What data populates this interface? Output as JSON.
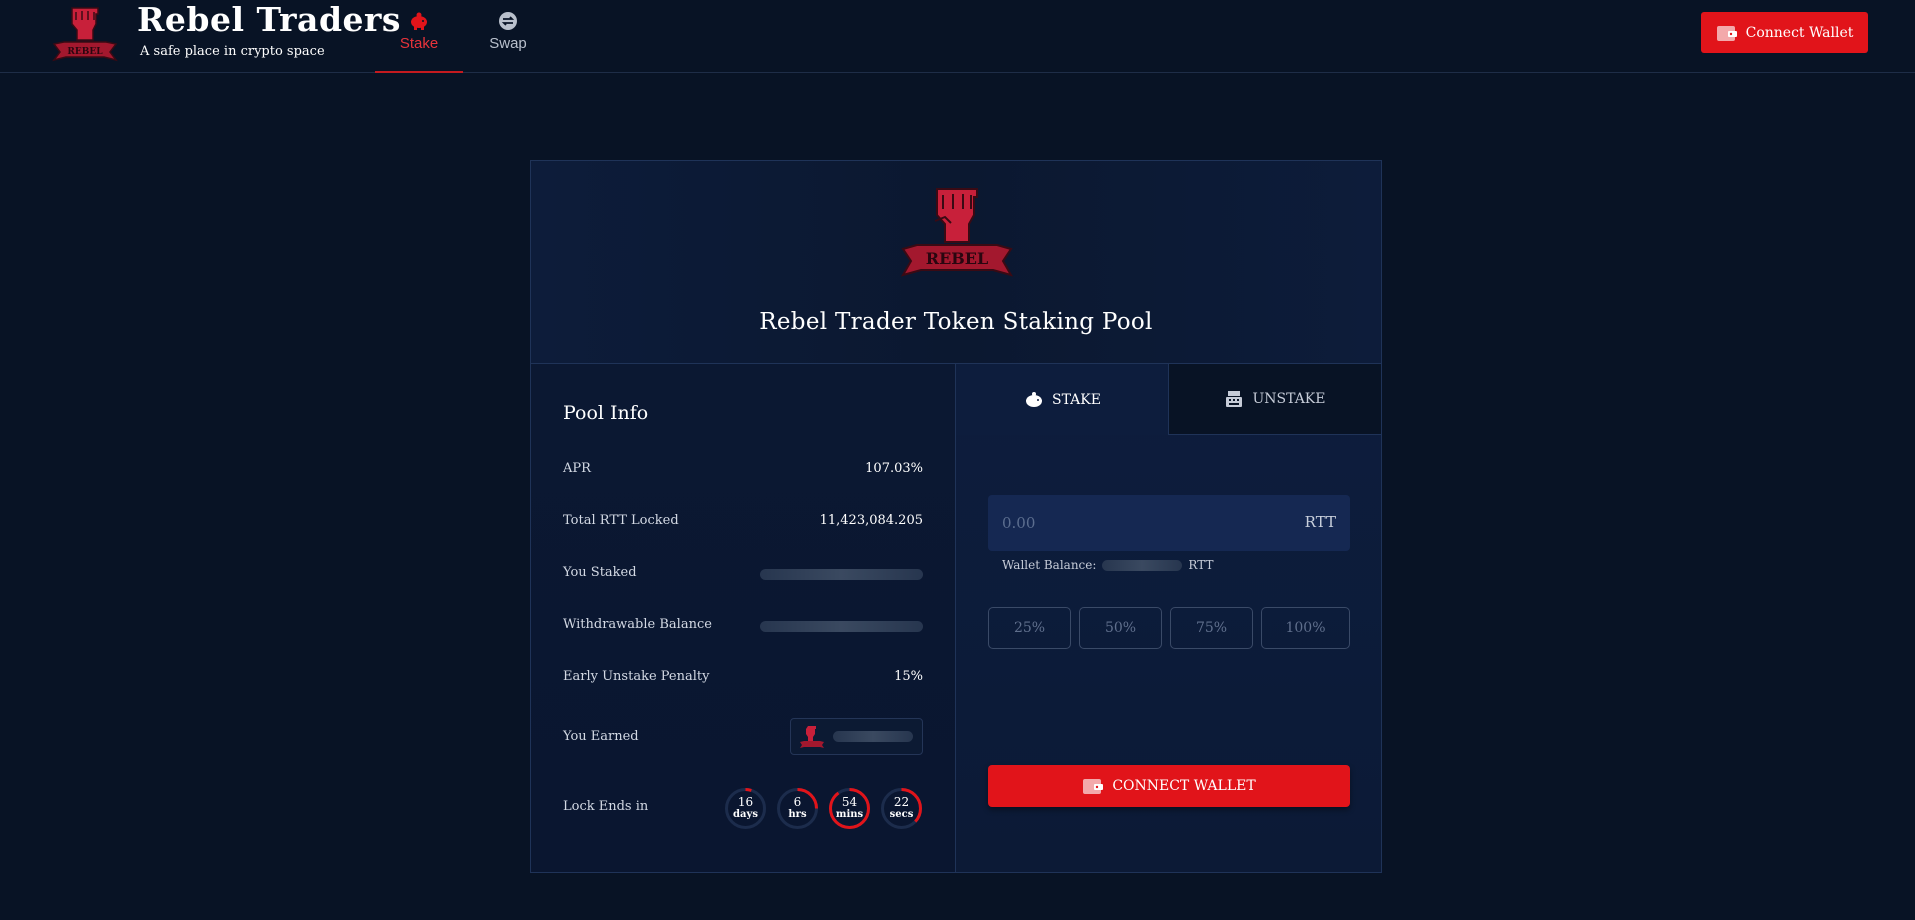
{
  "colors": {
    "background": "#081325",
    "accent": "#e1141a",
    "card": "#0c1a34",
    "border": "#1f3358"
  },
  "header": {
    "logo_icon": "rebel-fist-logo",
    "title": "Rebel Traders",
    "subtitle": "A safe place in crypto space",
    "nav": [
      {
        "label": "Stake",
        "icon": "piggy-bank-icon",
        "active": true
      },
      {
        "label": "Swap",
        "icon": "swap-icon",
        "active": false
      }
    ],
    "connect_label": "Connect Wallet"
  },
  "pool": {
    "logo_icon": "rebel-fist-logo",
    "title": "Rebel Trader Token Staking Pool"
  },
  "pool_info": {
    "title": "Pool Info",
    "rows": [
      {
        "label": "APR",
        "value": "107.03%"
      },
      {
        "label": "Total RTT Locked",
        "value": "11,423,084.205"
      },
      {
        "label": "You Staked",
        "value": null
      },
      {
        "label": "Withdrawable Balance",
        "value": null
      },
      {
        "label": "Early Unstake Penalty",
        "value": "15%"
      },
      {
        "label": "You Earned",
        "value": null
      },
      {
        "label": "Lock Ends in",
        "value": null
      }
    ],
    "lock_timer": [
      {
        "value": "16",
        "unit": "days",
        "progress": 0.05
      },
      {
        "value": "6",
        "unit": "hrs",
        "progress": 0.25
      },
      {
        "value": "54",
        "unit": "mins",
        "progress": 0.9
      },
      {
        "value": "22",
        "unit": "secs",
        "progress": 0.37
      }
    ]
  },
  "stake_panel": {
    "tabs": [
      {
        "label": "STAKE",
        "icon": "piggy-bank-icon",
        "active": true
      },
      {
        "label": "UNSTAKE",
        "icon": "cash-register-icon",
        "active": false
      }
    ],
    "amount_placeholder": "0.00",
    "amount_unit": "RTT",
    "wallet_balance_label": "Wallet Balance:",
    "wallet_balance_unit": "RTT",
    "percent_buttons": [
      "25%",
      "50%",
      "75%",
      "100%"
    ],
    "connect_label": "CONNECT WALLET"
  }
}
